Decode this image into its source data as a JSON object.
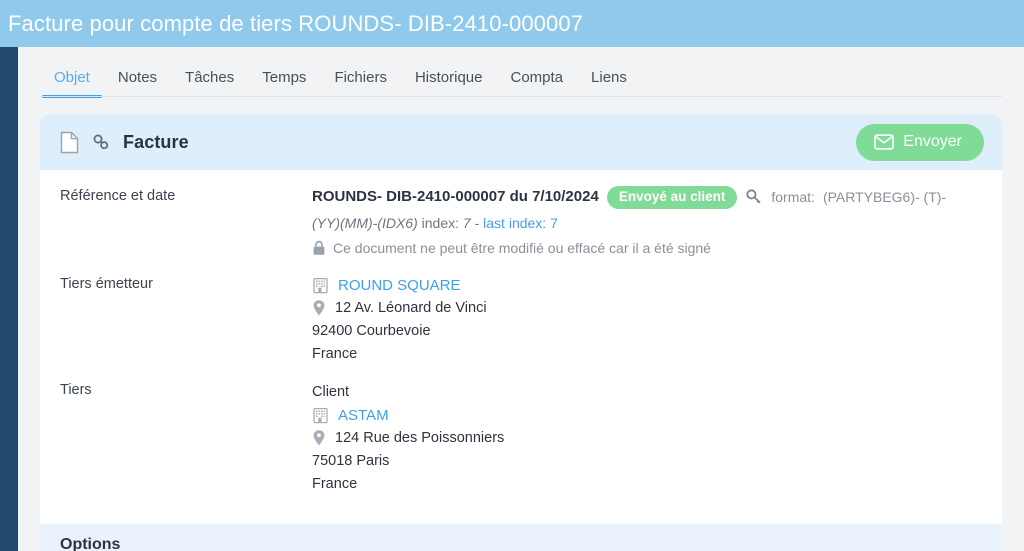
{
  "header": {
    "title": "Facture pour compte de tiers ROUNDS- DIB-2410-000007",
    "bg_color": "#8FC9EC",
    "text_color": "#FFFFFF"
  },
  "sidebar": {
    "rail_color": "#214A6E"
  },
  "tabs": [
    {
      "label": "Objet",
      "active": true
    },
    {
      "label": "Notes",
      "active": false
    },
    {
      "label": "Tâches",
      "active": false
    },
    {
      "label": "Temps",
      "active": false
    },
    {
      "label": "Fichiers",
      "active": false
    },
    {
      "label": "Historique",
      "active": false
    },
    {
      "label": "Compta",
      "active": false
    },
    {
      "label": "Liens",
      "active": false
    }
  ],
  "card": {
    "head": {
      "doc_icon": "document-icon",
      "link_icon": "link-icon",
      "title": "Facture",
      "send_button": {
        "label": "Envoyer",
        "icon": "envelope-icon",
        "color": "#7FDB96"
      },
      "bg_color": "#DEEEFB"
    },
    "rows": {
      "reference": {
        "label": "Référence et date",
        "ref_and_date": "ROUNDS- DIB-2410-000007 du 7/10/2024",
        "status_badge": "Envoyé au client",
        "status_color": "#7FDB96",
        "key_icon": "key-icon",
        "format_label": "format:",
        "format_value_1": "(PARTYBEG6)- (T)-",
        "format_value_2": "(YY)(MM)-(IDX6)",
        "index_label": "index:",
        "index_value": "7",
        "separator": "-",
        "last_index": "last index: 7",
        "lock_icon": "lock-icon",
        "signed_note": "Ce document ne peut être modifié ou effacé car il a été signé"
      },
      "issuer": {
        "label": "Tiers émetteur",
        "company_icon": "building-icon",
        "company": "ROUND SQUARE",
        "pin_icon": "map-pin-icon",
        "street": "12 Av. Léonard de Vinci",
        "city": "92400 Courbevoie",
        "country": "France"
      },
      "party": {
        "label": "Tiers",
        "type": "Client",
        "company_icon": "building-icon",
        "company": "ASTAM",
        "pin_icon": "map-pin-icon",
        "street": "124 Rue des Poissonniers",
        "city": "75018 Paris",
        "country": "France"
      }
    }
  },
  "options_section": {
    "title": "Options"
  }
}
